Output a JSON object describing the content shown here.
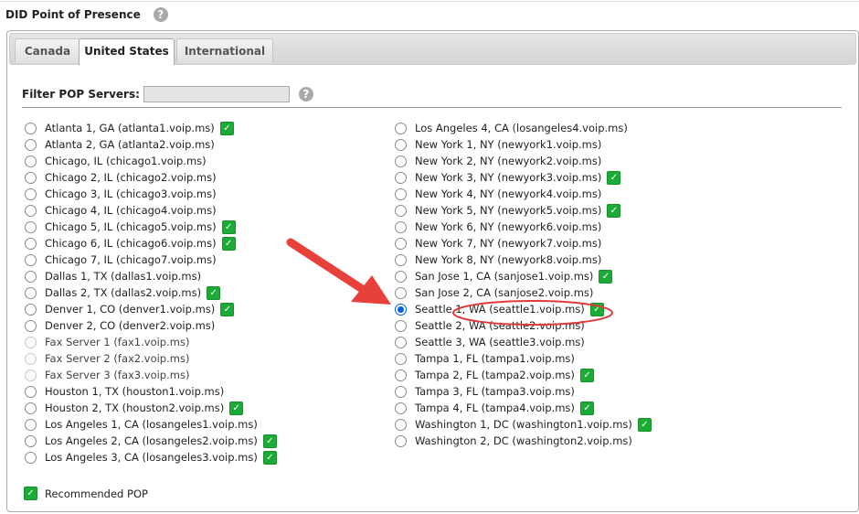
{
  "section_title": "DID Point of Presence",
  "help_glyph": "?",
  "tabs": [
    {
      "label": "Canada",
      "active": false
    },
    {
      "label": "United States",
      "active": true
    },
    {
      "label": "International",
      "active": false
    }
  ],
  "filter": {
    "label": "Filter POP Servers:",
    "value": ""
  },
  "check_glyph": "✓",
  "servers_left": [
    {
      "label": "Atlanta 1, GA (atlanta1.voip.ms)",
      "recommended": true,
      "selected": false,
      "disabled": false
    },
    {
      "label": "Atlanta 2, GA (atlanta2.voip.ms)",
      "recommended": false,
      "selected": false,
      "disabled": false
    },
    {
      "label": "Chicago, IL (chicago1.voip.ms)",
      "recommended": false,
      "selected": false,
      "disabled": false
    },
    {
      "label": "Chicago 2, IL (chicago2.voip.ms)",
      "recommended": false,
      "selected": false,
      "disabled": false
    },
    {
      "label": "Chicago 3, IL (chicago3.voip.ms)",
      "recommended": false,
      "selected": false,
      "disabled": false
    },
    {
      "label": "Chicago 4, IL (chicago4.voip.ms)",
      "recommended": false,
      "selected": false,
      "disabled": false
    },
    {
      "label": "Chicago 5, IL (chicago5.voip.ms)",
      "recommended": true,
      "selected": false,
      "disabled": false
    },
    {
      "label": "Chicago 6, IL (chicago6.voip.ms)",
      "recommended": true,
      "selected": false,
      "disabled": false
    },
    {
      "label": "Chicago 7, IL (chicago7.voip.ms)",
      "recommended": false,
      "selected": false,
      "disabled": false
    },
    {
      "label": "Dallas 1, TX (dallas1.voip.ms)",
      "recommended": false,
      "selected": false,
      "disabled": false
    },
    {
      "label": "Dallas 2, TX (dallas2.voip.ms)",
      "recommended": true,
      "selected": false,
      "disabled": false
    },
    {
      "label": "Denver 1, CO (denver1.voip.ms)",
      "recommended": true,
      "selected": false,
      "disabled": false
    },
    {
      "label": "Denver 2, CO (denver2.voip.ms)",
      "recommended": false,
      "selected": false,
      "disabled": false
    },
    {
      "label": "Fax Server 1 (fax1.voip.ms)",
      "recommended": false,
      "selected": false,
      "disabled": true
    },
    {
      "label": "Fax Server 2 (fax2.voip.ms)",
      "recommended": false,
      "selected": false,
      "disabled": true
    },
    {
      "label": "Fax Server 3 (fax3.voip.ms)",
      "recommended": false,
      "selected": false,
      "disabled": true
    },
    {
      "label": "Houston 1, TX (houston1.voip.ms)",
      "recommended": false,
      "selected": false,
      "disabled": false
    },
    {
      "label": "Houston 2, TX (houston2.voip.ms)",
      "recommended": true,
      "selected": false,
      "disabled": false
    },
    {
      "label": "Los Angeles 1, CA (losangeles1.voip.ms)",
      "recommended": false,
      "selected": false,
      "disabled": false
    },
    {
      "label": "Los Angeles 2, CA (losangeles2.voip.ms)",
      "recommended": true,
      "selected": false,
      "disabled": false
    },
    {
      "label": "Los Angeles 3, CA (losangeles3.voip.ms)",
      "recommended": true,
      "selected": false,
      "disabled": false
    }
  ],
  "servers_right": [
    {
      "label": "Los Angeles 4, CA (losangeles4.voip.ms)",
      "recommended": false,
      "selected": false,
      "disabled": false
    },
    {
      "label": "New York 1, NY (newyork1.voip.ms)",
      "recommended": false,
      "selected": false,
      "disabled": false
    },
    {
      "label": "New York 2, NY (newyork2.voip.ms)",
      "recommended": false,
      "selected": false,
      "disabled": false
    },
    {
      "label": "New York 3, NY (newyork3.voip.ms)",
      "recommended": true,
      "selected": false,
      "disabled": false
    },
    {
      "label": "New York 4, NY (newyork4.voip.ms)",
      "recommended": false,
      "selected": false,
      "disabled": false
    },
    {
      "label": "New York 5, NY (newyork5.voip.ms)",
      "recommended": true,
      "selected": false,
      "disabled": false
    },
    {
      "label": "New York 6, NY (newyork6.voip.ms)",
      "recommended": false,
      "selected": false,
      "disabled": false
    },
    {
      "label": "New York 7, NY (newyork7.voip.ms)",
      "recommended": false,
      "selected": false,
      "disabled": false
    },
    {
      "label": "New York 8, NY (newyork8.voip.ms)",
      "recommended": false,
      "selected": false,
      "disabled": false
    },
    {
      "label": "San Jose 1, CA (sanjose1.voip.ms)",
      "recommended": true,
      "selected": false,
      "disabled": false
    },
    {
      "label": "San Jose 2, CA (sanjose2.voip.ms)",
      "recommended": false,
      "selected": false,
      "disabled": false
    },
    {
      "label": "Seattle 1, WA (seattle1.voip.ms)",
      "recommended": true,
      "selected": true,
      "disabled": false
    },
    {
      "label": "Seattle 2, WA (seattle2.voip.ms)",
      "recommended": false,
      "selected": false,
      "disabled": false
    },
    {
      "label": "Seattle 3, WA (seattle3.voip.ms)",
      "recommended": false,
      "selected": false,
      "disabled": false
    },
    {
      "label": "Tampa 1, FL (tampa1.voip.ms)",
      "recommended": false,
      "selected": false,
      "disabled": false
    },
    {
      "label": "Tampa 2, FL (tampa2.voip.ms)",
      "recommended": true,
      "selected": false,
      "disabled": false
    },
    {
      "label": "Tampa 3, FL (tampa3.voip.ms)",
      "recommended": false,
      "selected": false,
      "disabled": false
    },
    {
      "label": "Tampa 4, FL (tampa4.voip.ms)",
      "recommended": true,
      "selected": false,
      "disabled": false
    },
    {
      "label": "Washington 1, DC (washington1.voip.ms)",
      "recommended": true,
      "selected": false,
      "disabled": false
    },
    {
      "label": "Washington 2, DC (washington2.voip.ms)",
      "recommended": false,
      "selected": false,
      "disabled": false
    }
  ],
  "legend": {
    "label": "Recommended POP"
  },
  "annotation": {
    "arrow_color": "#e8413c",
    "ellipse_color": "#e03a3a",
    "arrow_icon": "arrow-icon",
    "highlight_icon": "highlight-ellipse"
  }
}
